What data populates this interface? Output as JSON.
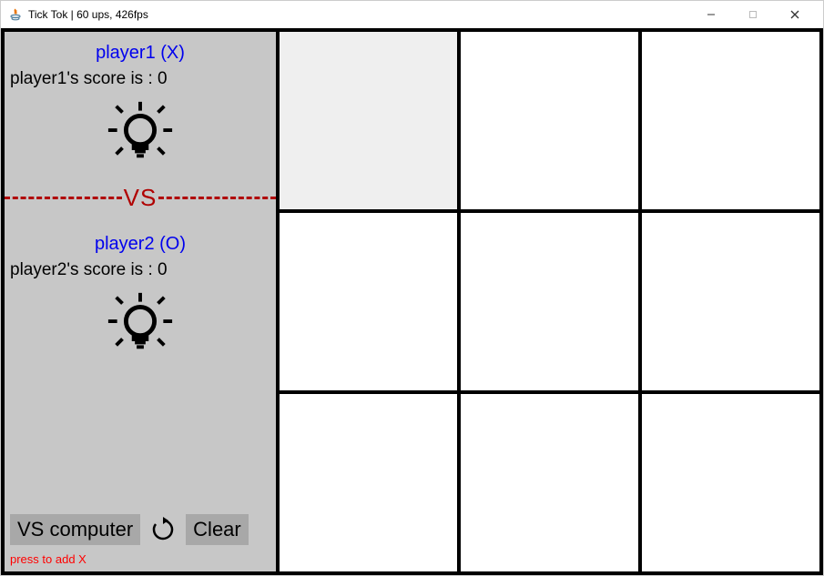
{
  "window": {
    "title": "Tick Tok  |  60 ups, 426fps"
  },
  "player1": {
    "name": "player1 (X)",
    "score_text": "player1's score is : 0"
  },
  "player2": {
    "name": "player2 (O)",
    "score_text": "player2's score is : 0"
  },
  "vs_label": "VS",
  "controls": {
    "vs_computer": "VS computer",
    "clear": "Clear"
  },
  "hint": "press to add X",
  "grid": {
    "cells": [
      "",
      "",
      "",
      "",
      "",
      "",
      "",
      "",
      ""
    ],
    "hover_index": 0
  }
}
